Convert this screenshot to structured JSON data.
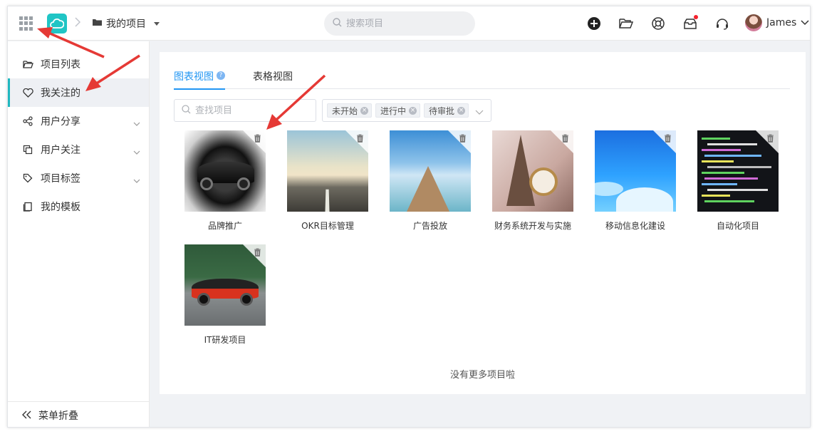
{
  "header": {
    "breadcrumb": "我的项目",
    "search_placeholder": "搜索项目",
    "user_name": "James"
  },
  "sidebar": {
    "items": [
      {
        "label": "项目列表",
        "icon": "folder-open-icon",
        "active": false,
        "expandable": false
      },
      {
        "label": "我关注的",
        "icon": "heart-icon",
        "active": true,
        "expandable": false
      },
      {
        "label": "用户分享",
        "icon": "share-icon",
        "active": false,
        "expandable": true
      },
      {
        "label": "用户关注",
        "icon": "copy-icon",
        "active": false,
        "expandable": true
      },
      {
        "label": "项目标签",
        "icon": "tag-icon",
        "active": false,
        "expandable": true
      },
      {
        "label": "我的模板",
        "icon": "template-icon",
        "active": false,
        "expandable": false
      }
    ],
    "collapse_label": "菜单折叠"
  },
  "tabs": [
    {
      "label": "图表视图",
      "active": true
    },
    {
      "label": "表格视图",
      "active": false
    }
  ],
  "filters": {
    "search_placeholder": "查找项目",
    "status_tags": [
      "未开始",
      "进行中",
      "待审批"
    ]
  },
  "projects": [
    {
      "title": "品牌推广",
      "image": "black-sports-car"
    },
    {
      "title": "OKR目标管理",
      "image": "open-road"
    },
    {
      "title": "广告投放",
      "image": "seaside-pier"
    },
    {
      "title": "财务系统开发与实施",
      "image": "eiffel-tower-clock"
    },
    {
      "title": "移动信息化建设",
      "image": "blue-winter-landscape"
    },
    {
      "title": "自动化项目",
      "image": "code-screen"
    },
    {
      "title": "IT研发项目",
      "image": "red-sports-car"
    }
  ],
  "footer_text": "没有更多项目啦",
  "colors": {
    "accent": "#2196f3",
    "logo": "#20c5c5",
    "annotation_arrow": "#e53935"
  }
}
